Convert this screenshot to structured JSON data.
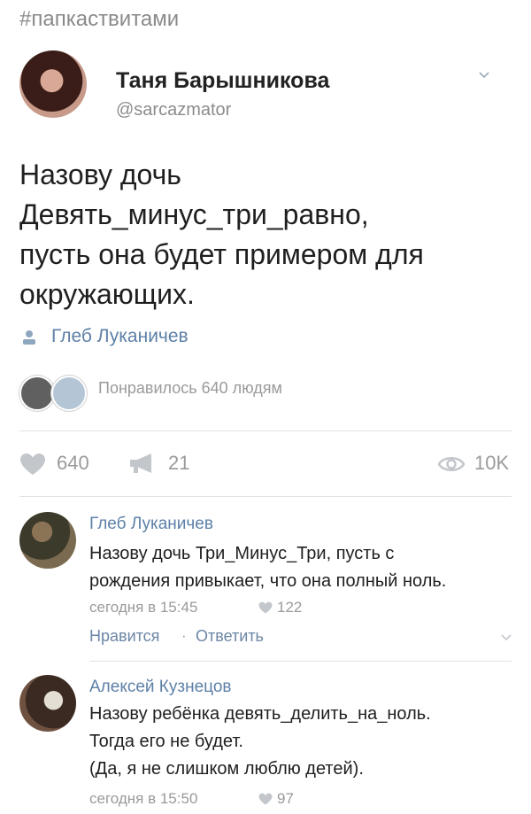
{
  "hashtag": "#папкаствитами",
  "post": {
    "author_name": "Таня Барышникова",
    "author_handle": "@sarcazmator",
    "text": "Назову дочь\nДевять_минус_три_равно,\nпусть она будет примером для\nокружающих.",
    "mention": "Глеб Луканичев",
    "likes_text": "Понравилось 640 людям",
    "likes_count": "640",
    "reposts_count": "21",
    "views_count": "10K"
  },
  "comments": [
    {
      "author": "Глеб Луканичев",
      "text": "Назову дочь Три_Минус_Три, пусть с\nрождения привыкает, что она полный ноль.",
      "time": "сегодня в 15:45",
      "likes": "122",
      "like_label": "Нравится",
      "reply_label": "Ответить"
    },
    {
      "author": "Алексей Кузнецов",
      "text": "Назову ребёнка девять_делить_на_ноль.\nТогда его не будет.\n(Да, я не слишком люблю детей).",
      "time": "сегодня в 15:50",
      "likes": "97"
    }
  ],
  "colors": {
    "link": "#5d80a8",
    "muted": "#9a9a9a"
  },
  "icons": [
    "chevron-down-icon",
    "user-icon",
    "heart-icon",
    "megaphone-icon",
    "eye-icon"
  ]
}
